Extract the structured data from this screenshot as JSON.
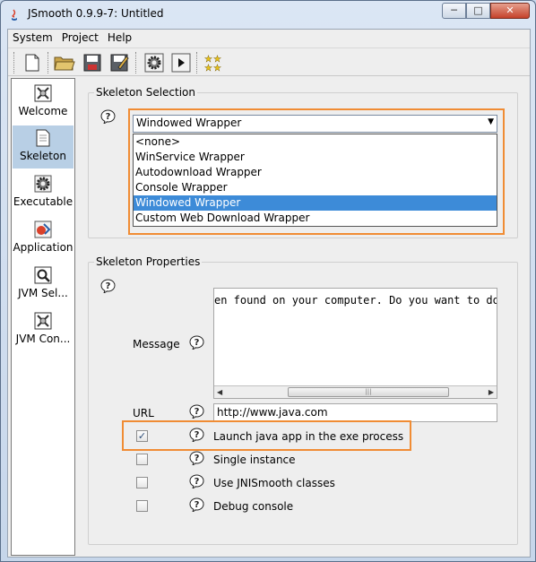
{
  "window": {
    "title": "JSmooth 0.9.9-7: Untitled",
    "minimize": "─",
    "maximize": "□",
    "close": "✕"
  },
  "menubar": {
    "items": [
      "System",
      "Project",
      "Help"
    ]
  },
  "toolbar": {
    "buttons": [
      {
        "icon": "new-file-icon"
      },
      {
        "icon": "open-folder-icon"
      },
      {
        "icon": "save-icon"
      },
      {
        "icon": "save-as-icon"
      },
      {
        "icon": "compile-gear-icon"
      },
      {
        "icon": "run-icon"
      },
      {
        "icon": "about-stars-icon"
      }
    ]
  },
  "nav": {
    "items": [
      {
        "label": "Welcome",
        "icon": "welcome-icon",
        "active": false
      },
      {
        "label": "Skeleton",
        "icon": "skeleton-icon",
        "active": true
      },
      {
        "label": "Executable",
        "icon": "executable-icon",
        "active": false
      },
      {
        "label": "Application",
        "icon": "application-icon",
        "active": false
      },
      {
        "label": "JVM Sel...",
        "icon": "jvm-selection-icon",
        "active": false
      },
      {
        "label": "JVM Con...",
        "icon": "jvm-config-icon",
        "active": false
      }
    ]
  },
  "skeleton_selection": {
    "title": "Skeleton Selection",
    "selected": "Windowed Wrapper",
    "options": [
      "<none>",
      "WinService Wrapper",
      "Autodownload Wrapper",
      "Console Wrapper",
      "Windowed Wrapper",
      "Custom Web Download Wrapper"
    ],
    "selected_index": 4
  },
  "skeleton_properties": {
    "title": "Skeleton Properties",
    "message_label": "Message",
    "message_text": "en found on your computer. Do you want to down",
    "url_label": "URL",
    "url_value": "http://www.java.com",
    "options": [
      {
        "label": "Launch java app in the exe process",
        "checked": true
      },
      {
        "label": "Single instance",
        "checked": false
      },
      {
        "label": "Use JNISmooth classes",
        "checked": false
      },
      {
        "label": "Debug console",
        "checked": false
      }
    ]
  },
  "colors": {
    "highlight": "#f08c34",
    "selection": "#3d8bd8",
    "nav_active": "#b8cfe5"
  }
}
